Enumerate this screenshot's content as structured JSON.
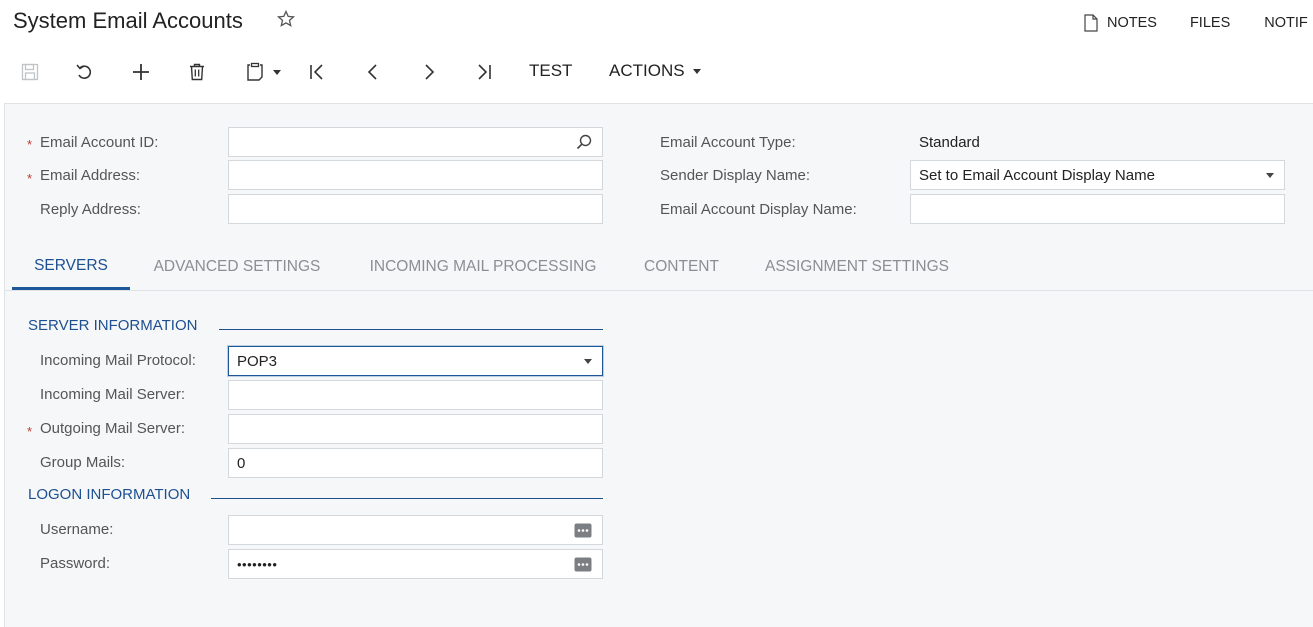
{
  "header": {
    "title": "System Email Accounts",
    "links": {
      "notes": "NOTES",
      "files": "FILES",
      "notifications": "NOTIF"
    }
  },
  "toolbar": {
    "test_label": "TEST",
    "actions_label": "ACTIONS"
  },
  "form": {
    "email_account_id": {
      "label": "Email Account ID:",
      "value": ""
    },
    "email_address": {
      "label": "Email Address:",
      "value": ""
    },
    "reply_address": {
      "label": "Reply Address:",
      "value": ""
    },
    "email_account_type": {
      "label": "Email Account Type:",
      "value": "Standard"
    },
    "sender_display_name": {
      "label": "Sender Display Name:",
      "value": "Set to Email Account Display Name"
    },
    "email_account_display_name": {
      "label": "Email Account Display Name:",
      "value": ""
    }
  },
  "tabs": [
    {
      "label": "SERVERS",
      "active": true
    },
    {
      "label": "ADVANCED SETTINGS",
      "active": false
    },
    {
      "label": "INCOMING MAIL PROCESSING",
      "active": false
    },
    {
      "label": "CONTENT",
      "active": false
    },
    {
      "label": "ASSIGNMENT SETTINGS",
      "active": false
    }
  ],
  "servers": {
    "server_info_header": "SERVER INFORMATION",
    "incoming_protocol": {
      "label": "Incoming Mail Protocol:",
      "value": "POP3"
    },
    "incoming_server": {
      "label": "Incoming Mail Server:",
      "value": ""
    },
    "outgoing_server": {
      "label": "Outgoing Mail Server:",
      "value": ""
    },
    "group_mails": {
      "label": "Group Mails:",
      "value": "0"
    },
    "logon_info_header": "LOGON INFORMATION",
    "username": {
      "label": "Username:",
      "value": ""
    },
    "password": {
      "label": "Password:",
      "value": "••••••••"
    }
  },
  "colors": {
    "accent": "#1d4f91",
    "required": "#c0392b",
    "panel_bg": "#f5f7f9"
  }
}
